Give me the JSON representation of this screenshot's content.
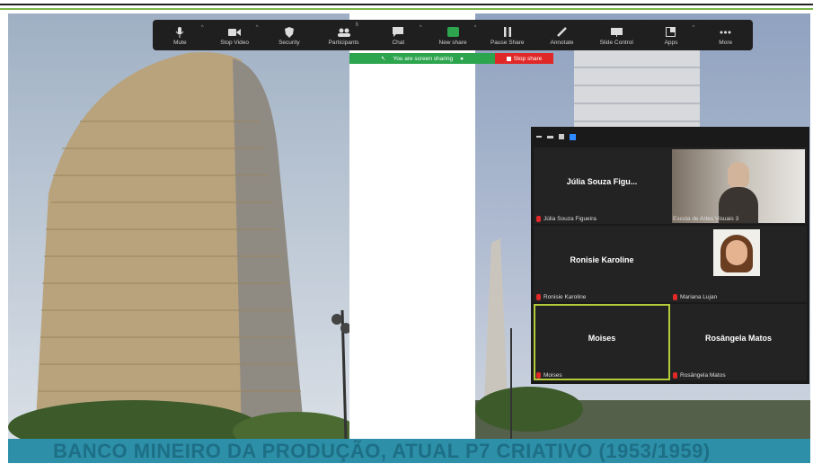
{
  "toolbar": {
    "items": [
      {
        "label": "Mute",
        "icon": "mic-icon"
      },
      {
        "label": "Stop Video",
        "icon": "video-icon"
      },
      {
        "label": "Security",
        "icon": "shield-icon"
      },
      {
        "label": "Participants",
        "icon": "participants-icon",
        "count": "6"
      },
      {
        "label": "Chat",
        "icon": "chat-icon"
      },
      {
        "label": "New share",
        "icon": "share-icon"
      },
      {
        "label": "Pause Share",
        "icon": "pause-icon"
      },
      {
        "label": "Annotate",
        "icon": "pen-icon"
      },
      {
        "label": "Slide Control",
        "icon": "slide-icon"
      },
      {
        "label": "Apps",
        "icon": "apps-icon"
      },
      {
        "label": "More",
        "icon": "more-icon"
      }
    ]
  },
  "share_banner": {
    "status": "You are screen sharing",
    "stop_label": "Stop share",
    "colors": {
      "sharing": "#2da44e",
      "stop": "#e02828"
    }
  },
  "gallery": {
    "tiles": [
      {
        "display_name": "Júlia Souza Figu...",
        "label": "Júlia Souza Figueira",
        "muted": true,
        "video": false
      },
      {
        "display_name": "",
        "label": "Escola de Artes Visuais 3",
        "muted": false,
        "video": true
      },
      {
        "display_name": "Ronisie Karoline",
        "label": "Ronisie Karoline",
        "muted": true,
        "video": false
      },
      {
        "display_name": "",
        "label": "Mariana Lujan",
        "muted": true,
        "video": true
      },
      {
        "display_name": "Moises",
        "label": "Moises",
        "muted": true,
        "video": false,
        "active_speaker": true
      },
      {
        "display_name": "Rosângela Matos",
        "label": "Rosângela Matos",
        "muted": true,
        "video": false
      }
    ]
  },
  "slide": {
    "caption": "BANCO MINEIRO DA PRODUÇÃO, ATUAL P7 CRIATIVO (1953/1959)",
    "caption_color": "#1d6f86",
    "bar_color": "#2d8fa8"
  }
}
